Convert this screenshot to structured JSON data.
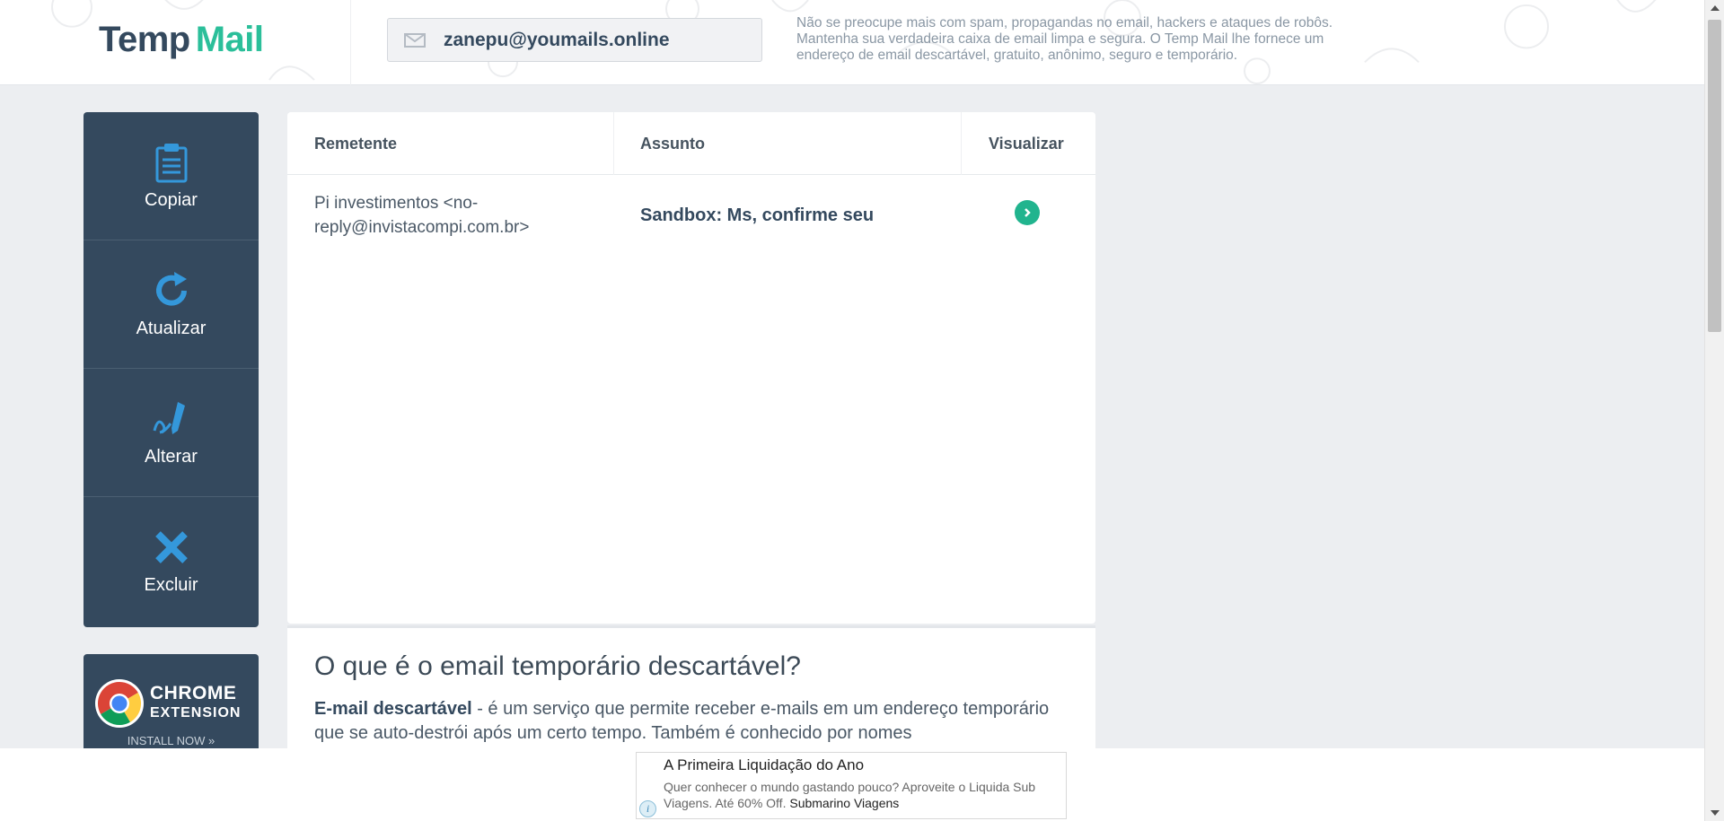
{
  "header": {
    "logo_part1": "Temp",
    "logo_part2": "Mail",
    "email": "zanepu@youmails.online",
    "description": "Não se preocupe mais com spam, propagandas no email, hackers e ataques de robôs. Mantenha sua verdadeira caixa de email limpa e segura. O Temp Mail lhe fornece um endereço de email descartável, gratuito, anônimo, seguro e temporário."
  },
  "sidebar": {
    "items": [
      {
        "label": "Copiar",
        "icon": "clipboard-icon"
      },
      {
        "label": "Atualizar",
        "icon": "refresh-icon"
      },
      {
        "label": "Alterar",
        "icon": "edit-icon"
      },
      {
        "label": "Excluir",
        "icon": "delete-icon"
      }
    ]
  },
  "chrome_extension": {
    "title": "CHROME",
    "subtitle": "EXTENSION",
    "install": "INSTALL NOW »"
  },
  "inbox": {
    "columns": [
      "Remetente",
      "Assunto",
      "Visualizar"
    ],
    "rows": [
      {
        "sender_line1": "Pi investimentos <no-",
        "sender_line2": "reply@invistacompi.com.br>",
        "subject": "Sandbox: Ms, confirme seu"
      }
    ]
  },
  "info": {
    "title": "O que é o email temporário descartável?",
    "bold_term": "E-mail descartável",
    "text": " - é um serviço que permite receber e-mails em um endereço temporário que se auto-destrói após um certo tempo. Também é conhecido por nomes"
  },
  "ad": {
    "title": "A Primeira Liquidação do Ano",
    "description": "Quer conhecer o mundo gastando pouco? Aproveite o Liquida Sub Viagens. Até 60% Off.",
    "advertiser": "Submarino Viagens",
    "info_symbol": "i"
  },
  "colors": {
    "brand_dark": "#34495e",
    "brand_green": "#2bbf9a",
    "accent_blue": "#3498db",
    "view_button": "#21b48e"
  }
}
